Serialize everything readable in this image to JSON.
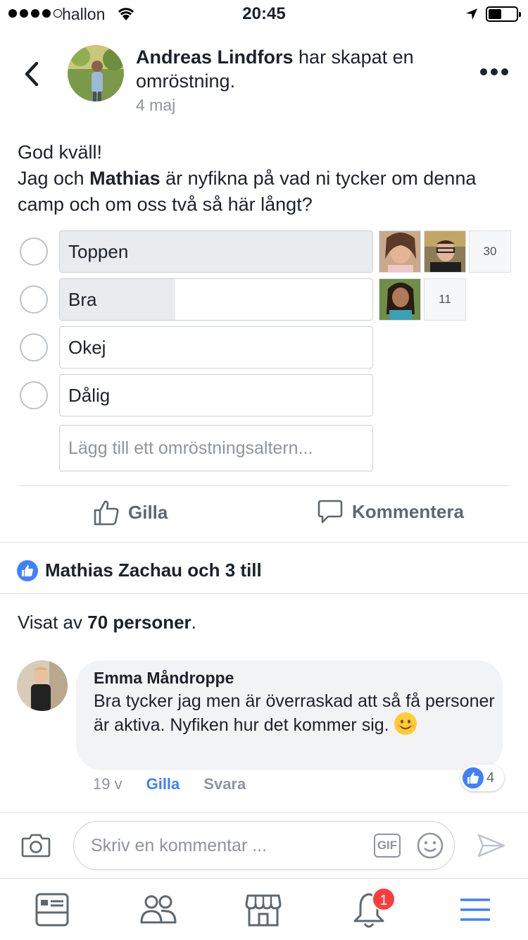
{
  "status_bar": {
    "carrier": "hallon",
    "time": "20:45"
  },
  "post": {
    "author_name": "Andreas Lindfors",
    "author_action": " har skapat en omröstning.",
    "date": "4 maj",
    "text_line1": "God kväll!",
    "text_line2_a": "Jag och ",
    "text_line2_bold": "Mathias",
    "text_line2_b": " är nyfikna på vad ni tycker om denna camp och om oss två så här långt?"
  },
  "poll": {
    "options": [
      {
        "label": "Toppen",
        "votes": "30",
        "fill": 1.0
      },
      {
        "label": "Bra",
        "votes": "11",
        "fill": 0.37
      },
      {
        "label": "Okej"
      },
      {
        "label": "Dålig"
      }
    ],
    "add_placeholder": "Lägg till ett omröstningsaltern..."
  },
  "actions": {
    "like": "Gilla",
    "comment": "Kommentera"
  },
  "likes_summary": "Mathias Zachau och 3 till",
  "views": {
    "prefix": "Visat av ",
    "bold": "70 personer",
    "suffix": "."
  },
  "comment": {
    "author": "Emma Måndroppe",
    "text": "Bra tycker jag men är överraskad att så få personer är aktiva. Nyfiken hur det kommer sig. ",
    "time": "19 v",
    "like": "Gilla",
    "reply": "Svara",
    "reactions": "4"
  },
  "composer": {
    "placeholder": "Skriv en kommentar ...",
    "gif_label": "GIF"
  },
  "tabbar": {
    "notifications_badge": "1"
  },
  "colors": {
    "facebook_blue": "#4080ff",
    "text": "#1d2129",
    "secondary_text": "#90949c",
    "badge_red": "#fa3e3e"
  }
}
